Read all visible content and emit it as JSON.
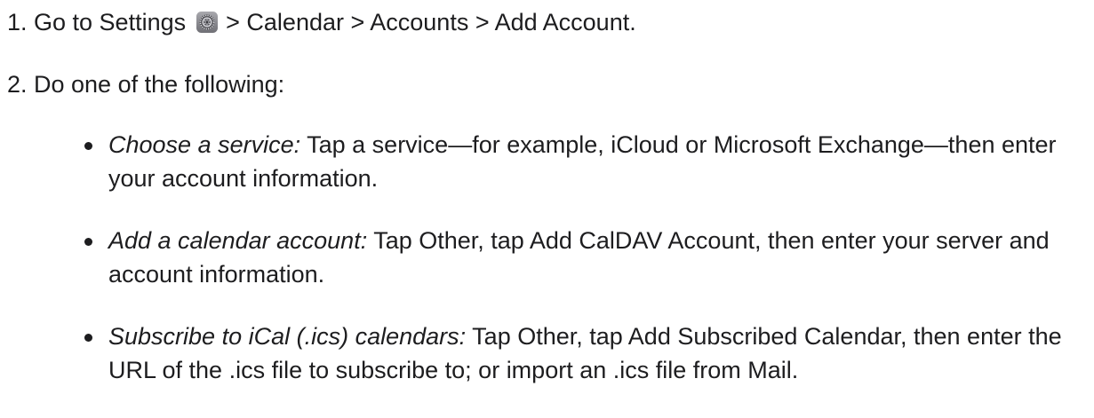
{
  "steps": [
    {
      "number": "1.",
      "segments": [
        "Go to Settings",
        "> Calendar > Accounts > Add Account."
      ],
      "icon": "settings-gear-icon"
    },
    {
      "number": "2.",
      "text": "Do one of the following:"
    }
  ],
  "options": [
    {
      "lead": "Choose a service:",
      "text": "Tap a service—for example, iCloud or Microsoft Exchange—then enter your account information."
    },
    {
      "lead": "Add a calendar account:",
      "text": "Tap Other, tap Add CalDAV Account, then enter your server and account information."
    },
    {
      "lead": "Subscribe to iCal (.ics) calendars:",
      "text": "Tap Other, tap Add Subscribed Calendar, then enter the URL of the .ics file to subscribe to; or import an .ics file from Mail."
    }
  ]
}
